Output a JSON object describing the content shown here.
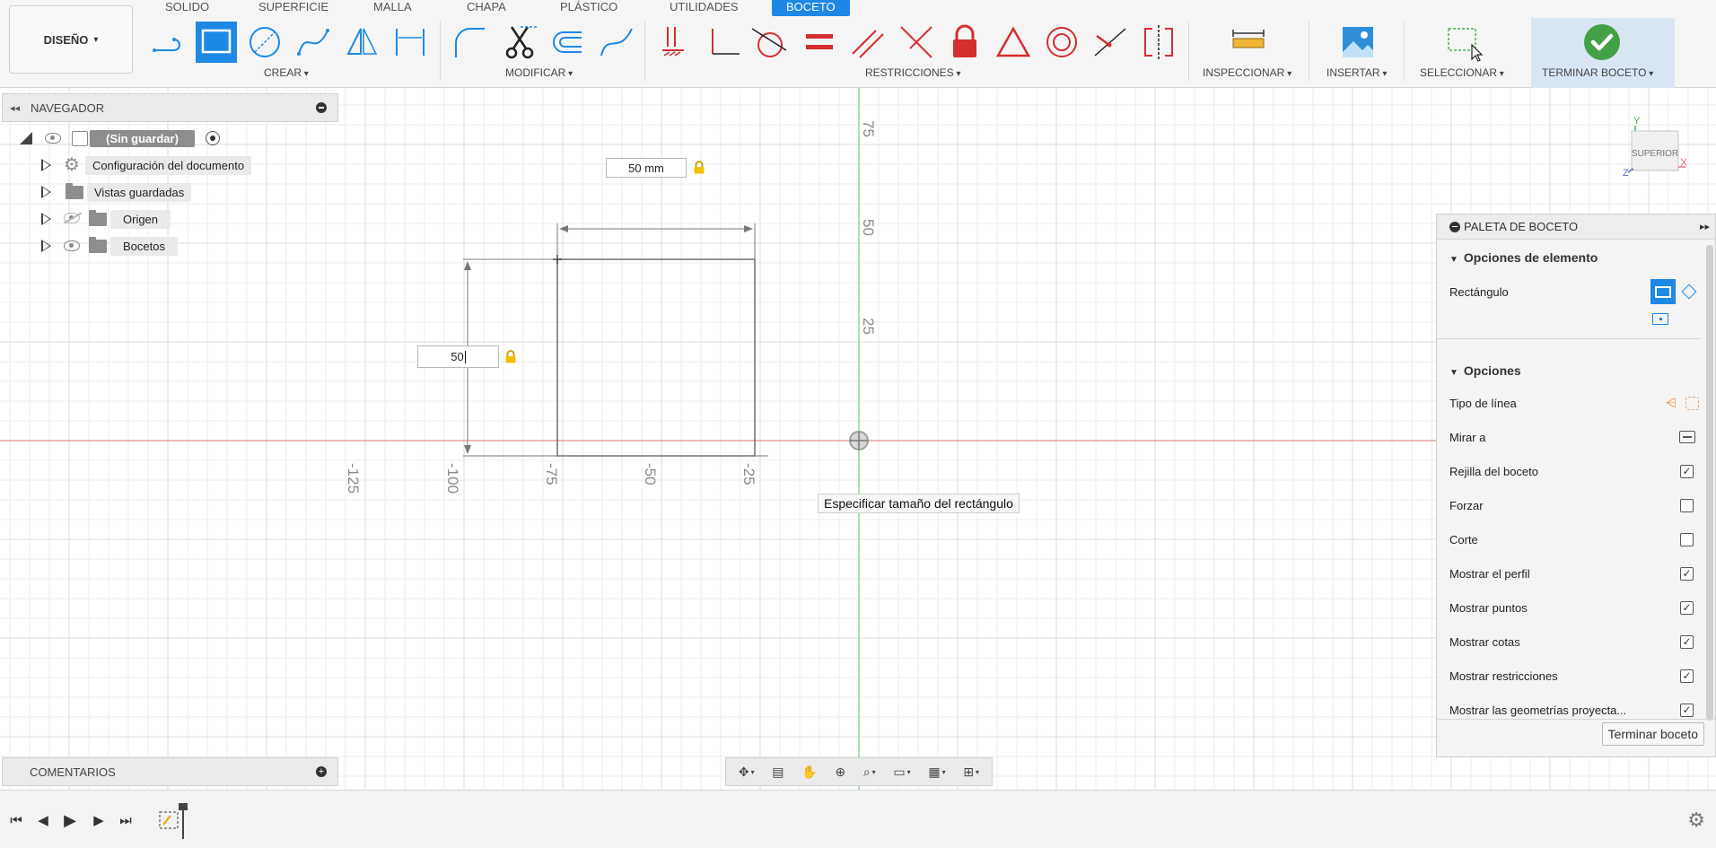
{
  "toolbar": {
    "workspace_menu": "DISEÑO",
    "tabs": [
      {
        "label": "SOLIDO"
      },
      {
        "label": "SUPERFICIE"
      },
      {
        "label": "MALLA"
      },
      {
        "label": "CHAPA"
      },
      {
        "label": "PLÁSTICO"
      },
      {
        "label": "UTILIDADES"
      },
      {
        "label": "BOCETO",
        "active": true
      }
    ],
    "groups": {
      "create": "CREAR",
      "modify": "MODIFICAR",
      "constraints": "RESTRICCIONES",
      "inspect": "INSPECCIONAR",
      "insert": "INSERTAR",
      "select": "SELECCIONAR",
      "finish": "TERMINAR BOCETO"
    },
    "accent": "#1e88e5",
    "constraint_color": "#d32f2f"
  },
  "navigator": {
    "title": "NAVEGADOR",
    "root": "(Sin guardar)",
    "items": [
      {
        "label": "Configuración del documento",
        "icon": "gear-icon"
      },
      {
        "label": "Vistas guardadas",
        "icon": "folder-icon"
      },
      {
        "label": "Origen",
        "icon": "folder-icon"
      },
      {
        "label": "Bocetos",
        "icon": "folder-icon"
      }
    ]
  },
  "sketch": {
    "width_dimension": "50 mm",
    "height_input": "50",
    "tooltip": "Especificar tamaño del rectángulo",
    "axis_labels_x": [
      "-125",
      "-100",
      "-75",
      "-50",
      "-25"
    ],
    "axis_labels_y": [
      "75",
      "50",
      "25"
    ]
  },
  "viewcube": {
    "face": "SUPERIOR",
    "x": "X",
    "y": "Y",
    "z": "Z"
  },
  "palette": {
    "title": "PALETA DE BOCETO",
    "element_options_title": "Opciones de elemento",
    "element_label": "Rectángulo",
    "options_title": "Opciones",
    "options": [
      {
        "label": "Tipo de línea",
        "type": "icons"
      },
      {
        "label": "Mirar a",
        "type": "icon"
      },
      {
        "label": "Rejilla del boceto",
        "checked": true
      },
      {
        "label": "Forzar",
        "checked": false
      },
      {
        "label": "Corte",
        "checked": false
      },
      {
        "label": "Mostrar el perfil",
        "checked": true
      },
      {
        "label": "Mostrar puntos",
        "checked": true
      },
      {
        "label": "Mostrar cotas",
        "checked": true
      },
      {
        "label": "Mostrar restricciones",
        "checked": true
      },
      {
        "label": "Mostrar las geometrías proyecta...",
        "checked": true
      }
    ],
    "finish_button": "Terminar boceto"
  },
  "comments": {
    "title": "COMENTARIOS"
  }
}
